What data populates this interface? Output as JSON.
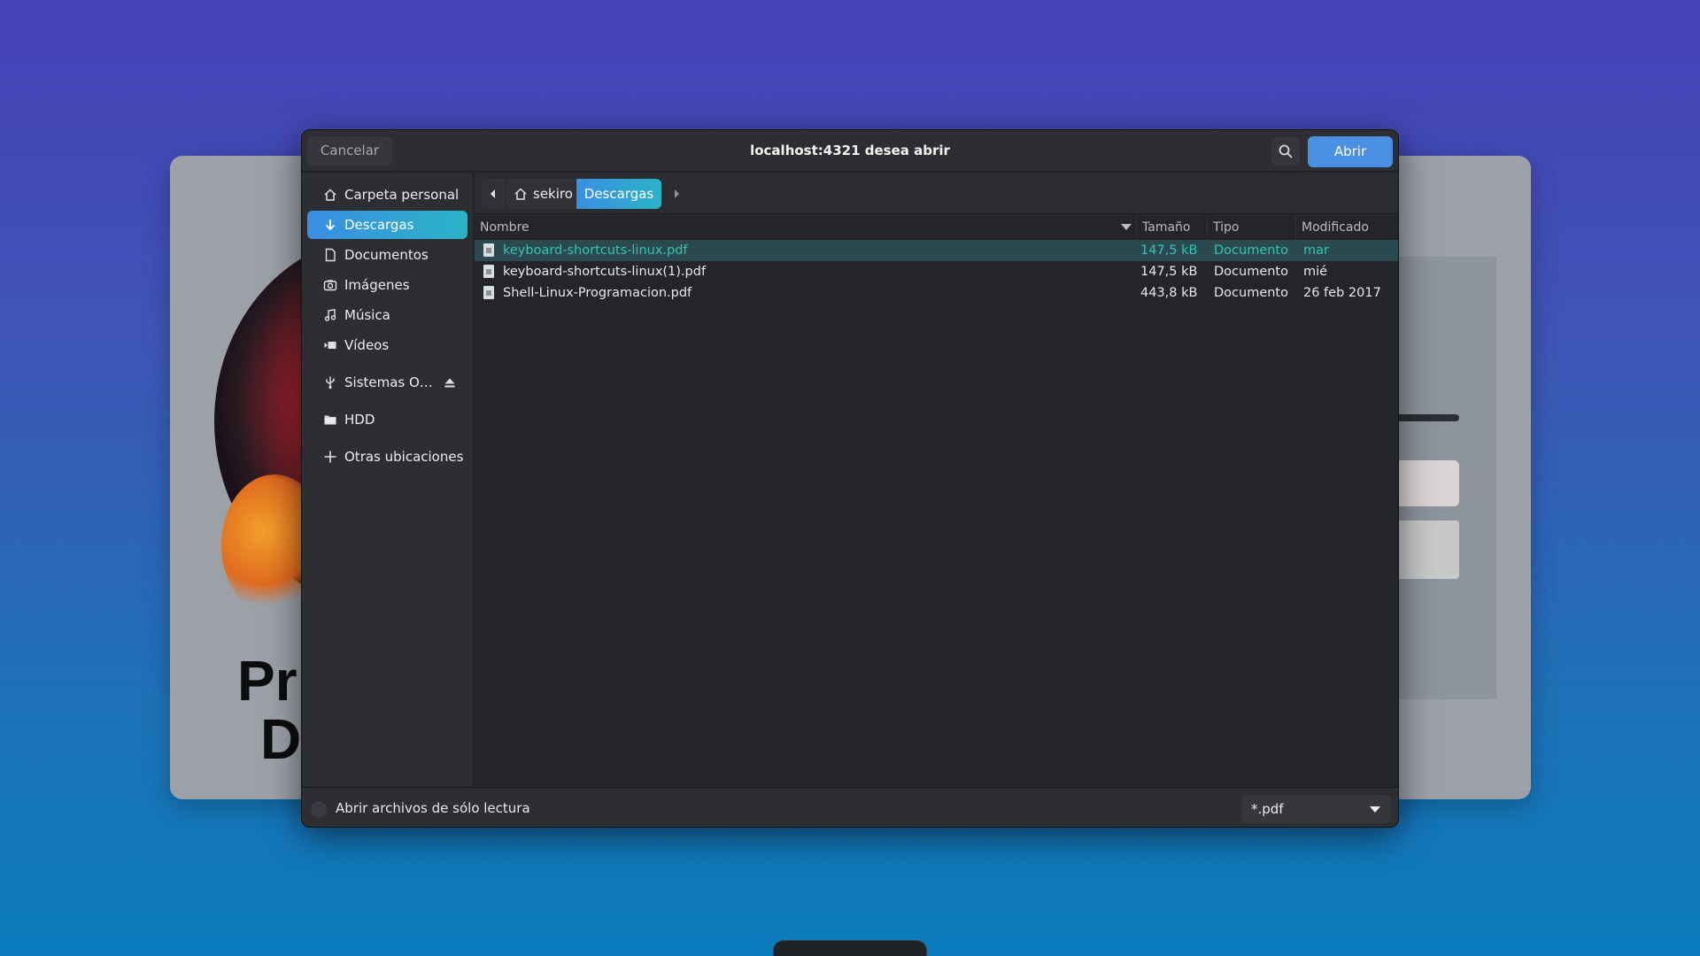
{
  "background": {
    "page_title_fragment": "Pr\nD"
  },
  "dialog": {
    "title": "localhost:4321 desea abrir",
    "cancel_label": "Cancelar",
    "open_label": "Abrir",
    "search_icon": "search-icon",
    "accent_color": "#3a8fe2"
  },
  "sidebar": {
    "items": [
      {
        "label": "Carpeta personal",
        "icon": "home-icon"
      },
      {
        "label": "Descargas",
        "icon": "download-icon",
        "active": true
      },
      {
        "label": "Documentos",
        "icon": "document-icon"
      },
      {
        "label": "Imágenes",
        "icon": "camera-icon"
      },
      {
        "label": "Música",
        "icon": "music-icon"
      },
      {
        "label": "Vídeos",
        "icon": "video-icon"
      },
      {
        "label": "Sistemas O…",
        "icon": "usb-icon",
        "eject": true
      },
      {
        "label": "HDD",
        "icon": "folder-icon"
      },
      {
        "label": "Otras ubicaciones",
        "icon": "plus-icon"
      }
    ]
  },
  "pathbar": {
    "home_label": "sekiro",
    "current_label": "Descargas"
  },
  "filelist": {
    "columns": [
      "Nombre",
      "Tamaño",
      "Tipo",
      "Modificado"
    ],
    "rows": [
      {
        "name": "keyboard-shortcuts-linux.pdf",
        "size": "147,5 kB",
        "type": "Documento",
        "modified": "mar",
        "selected": true
      },
      {
        "name": "keyboard-shortcuts-linux(1).pdf",
        "size": "147,5 kB",
        "type": "Documento",
        "modified": "mié"
      },
      {
        "name": "Shell-Linux-Programacion.pdf",
        "size": "443,8 kB",
        "type": "Documento",
        "modified": "26 feb 2017"
      }
    ]
  },
  "footer": {
    "readonly_label": "Abrir archivos de sólo lectura",
    "filter_value": "*.pdf"
  }
}
